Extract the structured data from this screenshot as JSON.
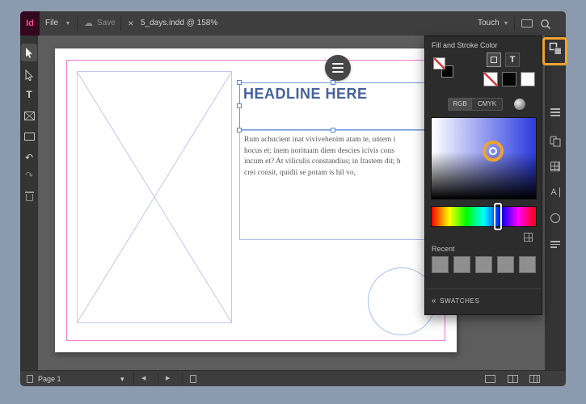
{
  "colors": {
    "annotation_accent": "#f0a32d",
    "headline_blue": "#46619c",
    "margin_guide_pink": "#f07ad0",
    "frame_guide_blue": "#a8c0ee",
    "brand_pink": "#ff4b96",
    "picker_hue_blue": "#2b3be0"
  },
  "top_bar": {
    "logo_text": "Id",
    "file_menu_label": "File",
    "save_label": "Save",
    "document_tab": "5_days.indd @ 158%",
    "touch_label": "Touch"
  },
  "document": {
    "headline": "HEADLINE HERE",
    "body_lines": [
      "Rum achucient inat vivivehenim atam te, untem i",
      "hocus et; inem norituam diem descies icivis cons",
      "incum et? At viliculis constandius; in Itastem dit; h",
      "crei consit, quidii se potam is hil vo,"
    ]
  },
  "color_panel": {
    "title": "Fill and Stroke Color",
    "mode_rgb": "RGB",
    "mode_cmyk": "CMYK",
    "recent_label": "Recent",
    "swatches_label": "SWATCHES",
    "text_toggle": "T"
  },
  "status_bar": {
    "page_label": "Page 1"
  },
  "icons": {
    "caret_down": "▾",
    "close": "✕",
    "cloud": "☁",
    "undo": "↶",
    "redo": "↷",
    "prev_page": "◀",
    "next_page": "▶",
    "collapse_chevrons": "«",
    "type_tool": "T",
    "char_style": "A"
  }
}
